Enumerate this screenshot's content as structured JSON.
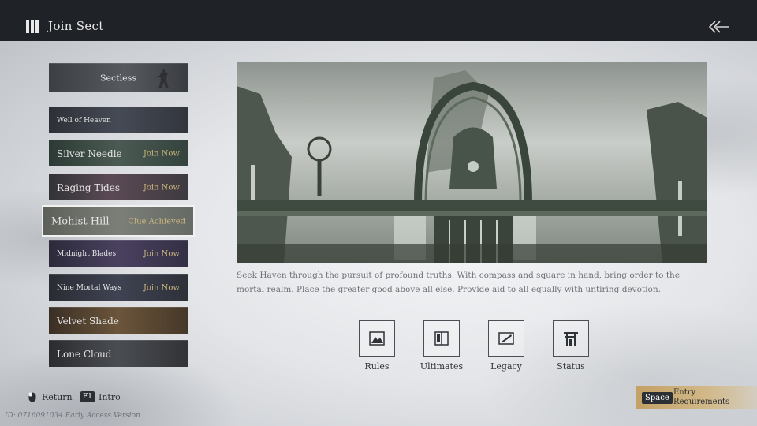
{
  "header": {
    "title": "Join Sect",
    "back_icon": "double-chevron-left-icon"
  },
  "sidebar": {
    "items": [
      {
        "name": "Sectless",
        "status": ""
      },
      {
        "name": "Well of Heaven",
        "status": ""
      },
      {
        "name": "Silver Needle",
        "status": "Join Now"
      },
      {
        "name": "Raging Tides",
        "status": "Join Now"
      },
      {
        "name": "Mohist Hill",
        "status": "Clue Achieved"
      },
      {
        "name": "Midnight Blades",
        "status": "Join Now"
      },
      {
        "name": "Nine Mortal Ways",
        "status": "Join Now"
      },
      {
        "name": "Velvet Shade",
        "status": ""
      },
      {
        "name": "Lone Cloud",
        "status": ""
      }
    ],
    "selected": "Mohist Hill"
  },
  "main": {
    "description": "Seek Haven through the pursuit of profound truths. With compass and square in hand, bring order to the mortal realm. Place the greater good above all else. Provide aid to all equally with untiring devotion.",
    "buttons": [
      {
        "label": "Rules",
        "icon": "rules-scroll-icon"
      },
      {
        "label": "Ultimates",
        "icon": "book-icon"
      },
      {
        "label": "Legacy",
        "icon": "brush-icon"
      },
      {
        "label": "Status",
        "icon": "gate-icon"
      }
    ]
  },
  "footer": {
    "return_label": "Return",
    "intro_key": "F1",
    "intro_label": "Intro",
    "version": "ID: 0716091034 Early Access Version",
    "space_key": "Space",
    "entry_label": "Entry Requirements"
  },
  "colors": {
    "topbar": "#1f2226",
    "status_gold": "#c9b57c",
    "entry_accent": "#c3a064"
  }
}
